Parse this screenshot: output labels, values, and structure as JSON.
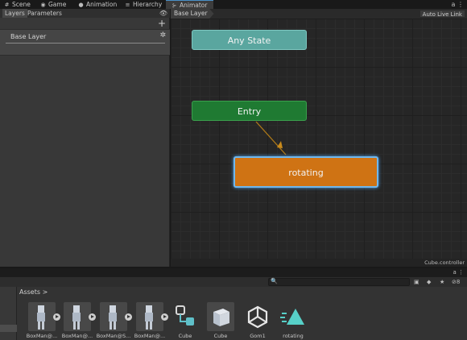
{
  "tabs": [
    {
      "label": "Scene",
      "icon": "grid-icon"
    },
    {
      "label": "Game",
      "icon": "gamepad-icon"
    },
    {
      "label": "Animation",
      "icon": "animation-icon"
    },
    {
      "label": "Hierarchy",
      "icon": "hierarchy-icon"
    },
    {
      "label": "Animator",
      "icon": "animator-icon",
      "active": true
    }
  ],
  "left_panel": {
    "subtabs": [
      "Layers",
      "Parameters"
    ],
    "layer_name": "Base Layer"
  },
  "graph": {
    "breadcrumb": "Base Layer",
    "live_link_label": "Auto Live Link",
    "states": {
      "any_state": "Any State",
      "entry": "Entry",
      "rotating": "rotating"
    },
    "footer_label": "Cube.controller"
  },
  "project": {
    "breadcrumb": "Assets",
    "zoom_count": "8",
    "assets": [
      {
        "label": "BoxMan@...",
        "kind": "model"
      },
      {
        "label": "BoxMan@...",
        "kind": "model"
      },
      {
        "label": "BoxMan@S...",
        "kind": "model"
      },
      {
        "label": "BoxMan@...",
        "kind": "model"
      },
      {
        "label": "Cube",
        "kind": "animator-controller"
      },
      {
        "label": "Cube",
        "kind": "cube-prefab"
      },
      {
        "label": "Gom1",
        "kind": "unity-asset"
      },
      {
        "label": "rotating",
        "kind": "animation-clip"
      }
    ]
  },
  "colors": {
    "any_state": "#5aa69f",
    "entry": "#1f7a32",
    "default_state": "#cf7314",
    "selection_glow": "#6fb7ee",
    "transition_arrow": "#b07a18"
  }
}
